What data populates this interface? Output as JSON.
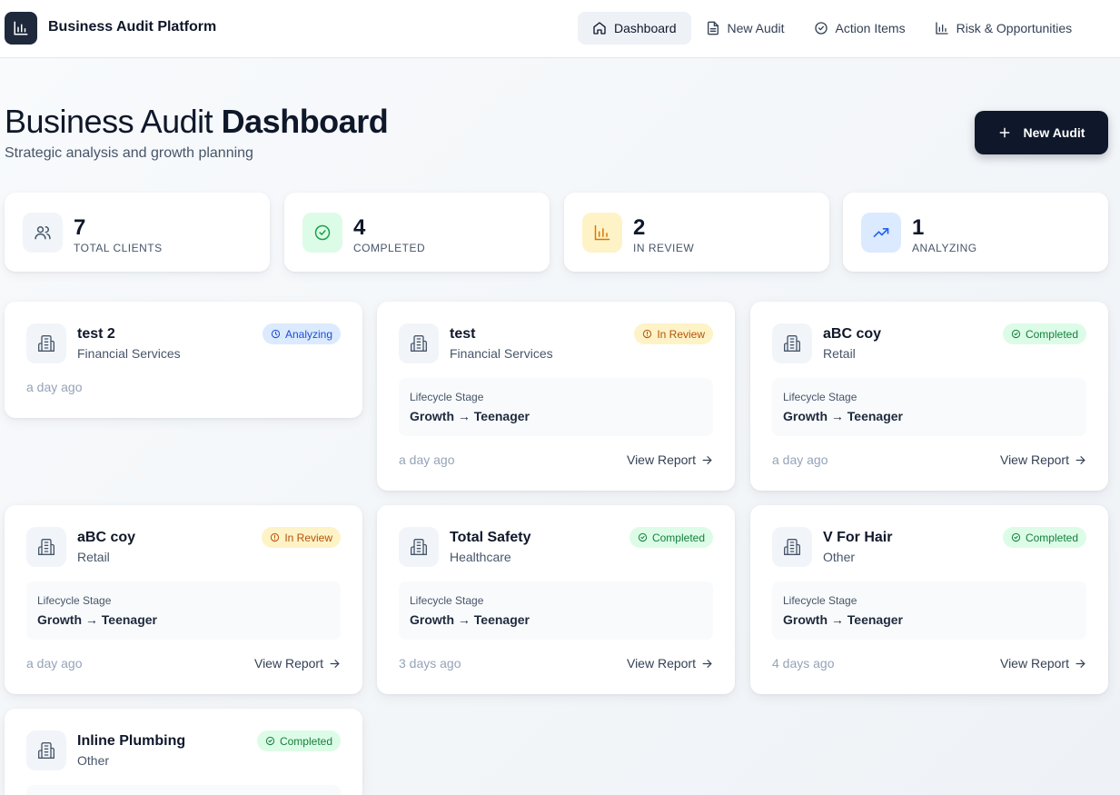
{
  "app": {
    "title": "Business Audit Platform"
  },
  "nav": [
    {
      "label": "Dashboard",
      "icon": "home-icon",
      "active": true
    },
    {
      "label": "New Audit",
      "icon": "document-icon",
      "active": false
    },
    {
      "label": "Action Items",
      "icon": "check-circle-icon",
      "active": false
    },
    {
      "label": "Risk & Opportunities",
      "icon": "bar-chart-icon",
      "active": false
    }
  ],
  "hero": {
    "title_light": "Business Audit ",
    "title_bold": "Dashboard",
    "subtitle": "Strategic analysis and growth planning",
    "new_button": "New Audit"
  },
  "stats": [
    {
      "value": "7",
      "label": "TOTAL CLIENTS",
      "icon": "users-icon",
      "color": "#f1f5f9",
      "icon_color": "#475569"
    },
    {
      "value": "4",
      "label": "COMPLETED",
      "icon": "check-circle-icon",
      "color": "#dcfce7",
      "icon_color": "#16a34a"
    },
    {
      "value": "2",
      "label": "IN REVIEW",
      "icon": "bar-chart-icon",
      "color": "#fef3c7",
      "icon_color": "#d97706"
    },
    {
      "value": "1",
      "label": "ANALYZING",
      "icon": "trending-up-icon",
      "color": "#dbeafe",
      "icon_color": "#2563eb"
    }
  ],
  "audits": [
    {
      "name": "test 2",
      "industry": "Financial Services",
      "status": "Analyzing",
      "status_key": "analyzing",
      "stage_label": "",
      "stage": "",
      "time": "a day ago",
      "view": ""
    },
    {
      "name": "test",
      "industry": "Financial Services",
      "status": "In Review",
      "status_key": "review",
      "stage_label": "Lifecycle Stage",
      "stage": "Growth → Teenager",
      "time": "a day ago",
      "view": "View Report"
    },
    {
      "name": "aBC coy",
      "industry": "Retail",
      "status": "Completed",
      "status_key": "completed",
      "stage_label": "Lifecycle Stage",
      "stage": "Growth → Teenager",
      "time": "a day ago",
      "view": "View Report"
    },
    {
      "name": "aBC coy",
      "industry": "Retail",
      "status": "In Review",
      "status_key": "review",
      "stage_label": "Lifecycle Stage",
      "stage": "Growth → Teenager",
      "time": "a day ago",
      "view": "View Report"
    },
    {
      "name": "Total Safety",
      "industry": "Healthcare",
      "status": "Completed",
      "status_key": "completed",
      "stage_label": "Lifecycle Stage",
      "stage": "Growth → Teenager",
      "time": "3 days ago",
      "view": "View Report"
    },
    {
      "name": "V For Hair",
      "industry": "Other",
      "status": "Completed",
      "status_key": "completed",
      "stage_label": "Lifecycle Stage",
      "stage": "Growth → Teenager",
      "time": "4 days ago",
      "view": "View Report"
    },
    {
      "name": "Inline Plumbing",
      "industry": "Other",
      "status": "Completed",
      "status_key": "completed",
      "stage_label": "",
      "stage": "",
      "time": "",
      "view": ""
    }
  ]
}
